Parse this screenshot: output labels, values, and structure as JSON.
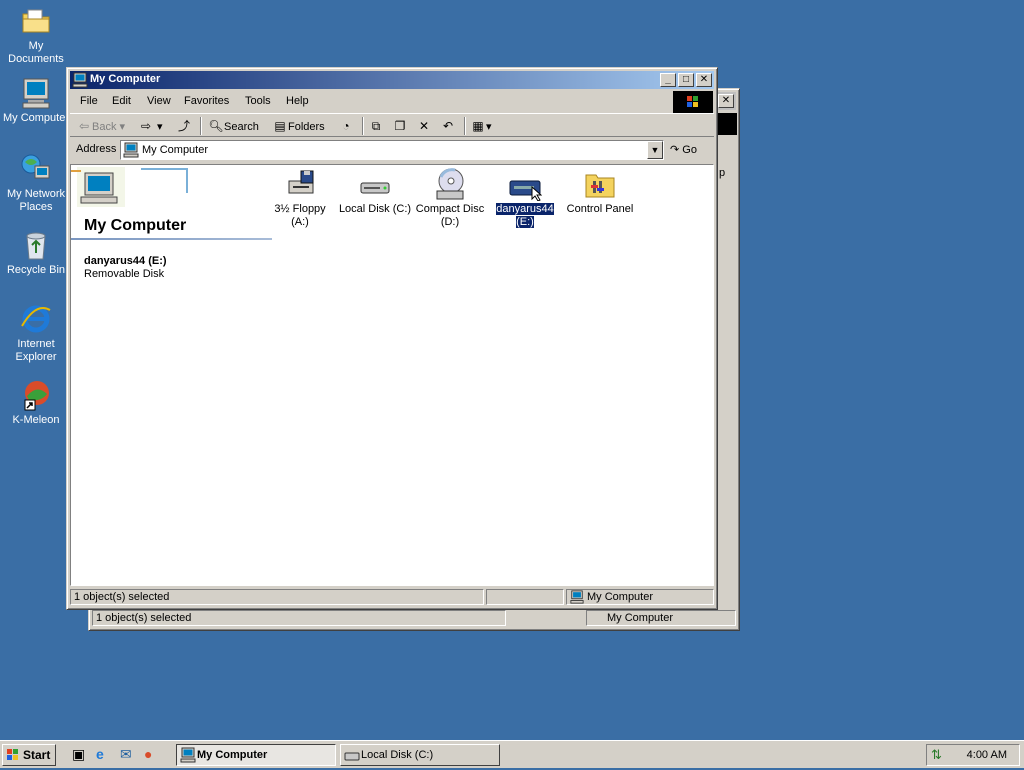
{
  "desktop": {
    "icons": [
      {
        "label": "My Documents"
      },
      {
        "label": "My Computer"
      },
      {
        "label": "My Network Places"
      },
      {
        "label": "Recycle Bin"
      },
      {
        "label": "Internet Explorer"
      },
      {
        "label": "K-Meleon"
      }
    ]
  },
  "back_window": {
    "status_left": "1 object(s) selected",
    "status_right": "My Computer",
    "title_fragment": "p"
  },
  "window": {
    "title": "My Computer",
    "menu": [
      "File",
      "Edit",
      "View",
      "Favorites",
      "Tools",
      "Help"
    ],
    "toolbar": {
      "back": "Back",
      "search": "Search",
      "folders": "Folders"
    },
    "address": {
      "label": "Address",
      "value": "My Computer",
      "go": "Go"
    },
    "left_panel": {
      "heading": "My Computer",
      "selected_name": "danyarus44 (E:)",
      "selected_type": "Removable Disk"
    },
    "items": [
      {
        "line1": "3½ Floppy",
        "line2": "(A:)",
        "icon": "floppy-drive-icon"
      },
      {
        "line1": "Local Disk (C:)",
        "line2": "",
        "icon": "hard-disk-icon"
      },
      {
        "line1": "Compact Disc",
        "line2": "(D:)",
        "icon": "cd-drive-icon"
      },
      {
        "line1": "danyarus44",
        "line2": "(E:)",
        "icon": "removable-disk-icon"
      },
      {
        "line1": "Control Panel",
        "line2": "",
        "icon": "control-panel-icon"
      }
    ],
    "status": {
      "left": "1 object(s) selected",
      "right": "My Computer"
    }
  },
  "taskbar": {
    "start": "Start",
    "tasks": [
      {
        "label": "My Computer"
      },
      {
        "label": "Local Disk (C:)"
      }
    ],
    "clock": "4:00 AM"
  },
  "colors": {
    "desktop": "#3a6ea5",
    "title_active": "#0a246a",
    "selection": "#0a246a"
  }
}
